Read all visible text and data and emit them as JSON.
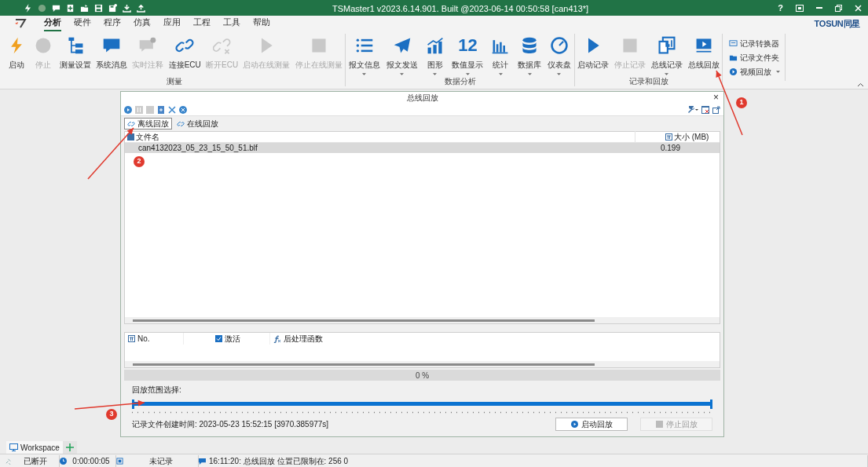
{
  "title_bar": {
    "title": "TSMaster1 v2023.6.14.901. Built @2023-06-14 00:50:58 [can413*]",
    "help": "?"
  },
  "menu": {
    "tabs": [
      {
        "label": "分析",
        "selected": true
      },
      {
        "label": "硬件",
        "selected": false
      },
      {
        "label": "程序",
        "selected": false
      },
      {
        "label": "仿真",
        "selected": false
      },
      {
        "label": "应用",
        "selected": false
      },
      {
        "label": "工程",
        "selected": false
      },
      {
        "label": "工具",
        "selected": false
      },
      {
        "label": "帮助",
        "selected": false
      }
    ],
    "brand": "TOSUN同星"
  },
  "ribbon": {
    "groups": [
      {
        "label": "测量",
        "buttons": [
          {
            "label": "启动",
            "disabled": false,
            "dropdown": false
          },
          {
            "label": "停止",
            "disabled": true,
            "dropdown": false
          },
          {
            "label": "测量设置",
            "disabled": false,
            "dropdown": false
          },
          {
            "label": "系统消息",
            "disabled": false,
            "dropdown": false
          },
          {
            "label": "实时注释",
            "disabled": true,
            "dropdown": false
          },
          {
            "label": "连接ECU",
            "disabled": false,
            "dropdown": false
          },
          {
            "label": "断开ECU",
            "disabled": true,
            "dropdown": false
          },
          {
            "label": "启动在线测量",
            "disabled": true,
            "dropdown": false
          },
          {
            "label": "停止在线测量",
            "disabled": true,
            "dropdown": false
          }
        ]
      },
      {
        "label": "数据分析",
        "buttons": [
          {
            "label": "报文信息",
            "disabled": false,
            "dropdown": true
          },
          {
            "label": "报文发送",
            "disabled": false,
            "dropdown": true
          },
          {
            "label": "图形",
            "disabled": false,
            "dropdown": true
          },
          {
            "label": "数值显示",
            "disabled": false,
            "dropdown": true,
            "icon_text": "12"
          },
          {
            "label": "统计",
            "disabled": false,
            "dropdown": true
          },
          {
            "label": "数据库",
            "disabled": false,
            "dropdown": true
          },
          {
            "label": "仪表盘",
            "disabled": false,
            "dropdown": true
          }
        ]
      },
      {
        "label": "记录和回放",
        "buttons": [
          {
            "label": "启动记录",
            "disabled": false,
            "dropdown": false
          },
          {
            "label": "停止记录",
            "disabled": true,
            "dropdown": false
          },
          {
            "label": "总线记录",
            "disabled": false,
            "dropdown": true
          },
          {
            "label": "总线回放",
            "disabled": false,
            "dropdown": false
          }
        ]
      }
    ],
    "side_items": [
      {
        "label": "记录转换器",
        "dropdown": false
      },
      {
        "label": "记录文件夹",
        "dropdown": false
      },
      {
        "label": "视频回放",
        "dropdown": true
      }
    ]
  },
  "dialog": {
    "title": "总线回放",
    "close": "×",
    "tabs": [
      {
        "label": "离线回放",
        "selected": true
      },
      {
        "label": "在线回放",
        "selected": false
      }
    ],
    "file_table": {
      "columns": [
        "文件名",
        "大小 (MB)"
      ],
      "rows": [
        {
          "cells": [
            "can4132023_05_23_15_50_51.blf",
            "0.199"
          ],
          "selected": true
        }
      ]
    },
    "signal_table": {
      "columns": [
        {
          "label": "No.",
          "kind": "text"
        },
        {
          "label": "激活",
          "kind": "checkbox",
          "checked": true
        },
        {
          "label": "后处理函数",
          "kind": "function"
        }
      ]
    },
    "progress": {
      "text": "0 %",
      "level": 0
    },
    "range": {
      "label": "回放范围选择:",
      "level": 1
    },
    "created": "记录文件创建时间: 2023-05-23 15:52:15 [3970.385977s]",
    "buttons": [
      {
        "label": "启动回放",
        "disabled": false
      },
      {
        "label": "停止回放",
        "disabled": true
      }
    ]
  },
  "workspace_tabs": [
    {
      "label": "Workspace",
      "selected": true
    }
  ],
  "status_bar": [
    "已断开",
    "0:00:00:05",
    "未记录",
    "16:11:20: 总线回放 位置已限制在: 256 0"
  ],
  "annotations": [
    {
      "label": "1"
    },
    {
      "label": "2"
    },
    {
      "label": "3"
    }
  ]
}
